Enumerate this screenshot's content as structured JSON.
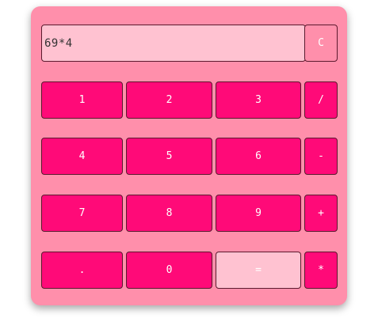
{
  "display": {
    "value": "69*4"
  },
  "buttons": {
    "clear": "C",
    "one": "1",
    "two": "2",
    "three": "3",
    "divide": "/",
    "four": "4",
    "five": "5",
    "six": "6",
    "minus": "-",
    "seven": "7",
    "eight": "8",
    "nine": "9",
    "plus": "+",
    "decimal": ".",
    "zero": "0",
    "equals": "=",
    "multiply": "*"
  },
  "colors": {
    "panel": "#ff8fab",
    "button": "#ff0a78",
    "display": "#ffc2d1",
    "equals": "#ffc2d1"
  }
}
